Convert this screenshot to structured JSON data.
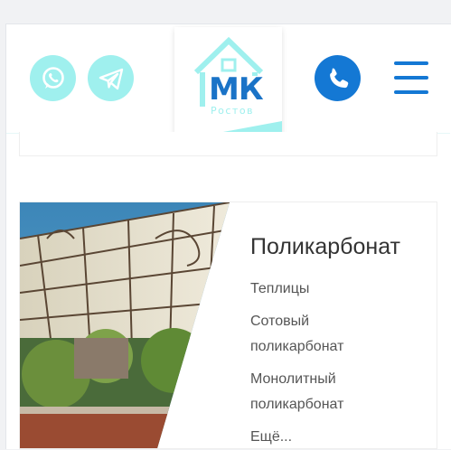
{
  "colors": {
    "social": "#9ff0ee",
    "phone": "#1478d4",
    "brand": "#1a73c7"
  },
  "header": {
    "icons": [
      "whatsapp-icon",
      "telegram-icon",
      "phone-icon",
      "menu-icon"
    ],
    "logo": {
      "letters": "МК",
      "city": "Ростов"
    }
  },
  "card": {
    "title": "Поликарбонат",
    "links": [
      {
        "line1": "Теплицы",
        "line2": ""
      },
      {
        "line1": "Сотовый",
        "line2": "поликарбонат"
      },
      {
        "line1": "Монолитный",
        "line2": "поликарбонат"
      },
      {
        "line1": "Ещё...",
        "line2": ""
      }
    ]
  }
}
